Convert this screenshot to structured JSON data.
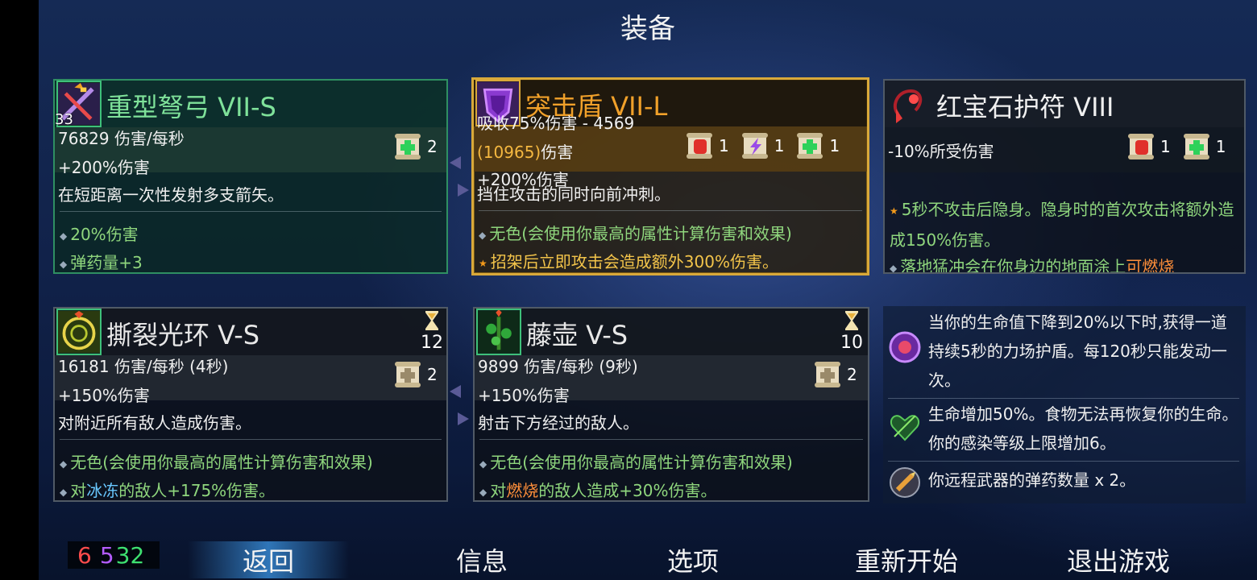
{
  "header": {
    "title": "装备"
  },
  "weapons": [
    {
      "name": "重型弩弓 VII-S",
      "level": "33",
      "dps": "76829 伤害/每秒",
      "bonus": "+200%伤害",
      "description": "在短距离一次性发射多支箭矢。",
      "scrolls": [
        {
          "icon": "health-scroll-icon",
          "count": "2"
        }
      ],
      "affixes": [
        "20%伤害",
        "弹药量+3"
      ]
    },
    {
      "name": "突击盾 VII-L",
      "block": "吸收75%伤害 - 4569",
      "damage_value": "(10965)",
      "damage_label": "伤害",
      "bonus": "+200%伤害",
      "description": "挡住攻击的同时向前冲刺。",
      "scrolls": [
        {
          "icon": "brutality-scroll-icon",
          "count": "1"
        },
        {
          "icon": "tactics-scroll-icon",
          "count": "1"
        },
        {
          "icon": "health-scroll-icon",
          "count": "1"
        }
      ],
      "affixes": [
        "无色(会使用你最高的属性计算伤害和效果)"
      ],
      "legendary_affix": "招架后立即攻击会造成额外300%伤害。"
    }
  ],
  "amulet": {
    "name": "红宝石护符 VIII",
    "stat": "-10%所受伤害",
    "scrolls": [
      {
        "icon": "brutality-scroll-icon",
        "count": "1"
      },
      {
        "icon": "health-scroll-icon",
        "count": "1"
      }
    ],
    "affix_1": "5秒不攻击后隐身。隐身时的首次攻击将额外造成150%伤害。",
    "affix_2_pre": "落地猛冲会在你身边的地面涂上",
    "affix_2_fire": "可燃烧"
  },
  "skills": [
    {
      "name": "撕裂光环 V-S",
      "cooldown": "12",
      "dps": "16181 伤害/每秒 (4秒)",
      "bonus": "+150%伤害",
      "description": "对附近所有敌人造成伤害。",
      "scrolls": [
        {
          "icon": "colorless-scroll-icon",
          "count": "2"
        }
      ],
      "affix_1": "无色(会使用你最高的属性计算伤害和效果)",
      "affix_2_pre": "对",
      "affix_2_keyword": "冰冻",
      "affix_2_post": "的敌人+175%伤害。"
    },
    {
      "name": "藤壶 V-S",
      "cooldown": "10",
      "dps": "9899 伤害/每秒 (9秒)",
      "bonus": "+150%伤害",
      "description": "射击下方经过的敌人。",
      "scrolls": [
        {
          "icon": "colorless-scroll-icon",
          "count": "2"
        }
      ],
      "affix_1": "无色(会使用你最高的属性计算伤害和效果)",
      "affix_2_pre": "对",
      "affix_2_keyword": "燃烧",
      "affix_2_post": "的敌人造成+30%伤害。"
    }
  ],
  "mutations": [
    {
      "icon": "force-shield-icon",
      "text": "当你的生命值下降到20%以下时,获得一道持续5秒的力场护盾。每120秒只能发动一次。"
    },
    {
      "icon": "vine-heart-icon",
      "text": "生命增加50%。食物无法再恢复你的生命。你的感染等级上限增加6。"
    },
    {
      "icon": "ammo-icon",
      "text": "你远程武器的弹药数量 x 2。"
    }
  ],
  "stats": {
    "brutality": "6",
    "tactics": "5",
    "survival": "32"
  },
  "menu": {
    "back": "返回",
    "info": "信息",
    "options": "选项",
    "restart": "重新开始",
    "quit": "退出游戏"
  },
  "colors": {
    "legendary": "#d9a93a",
    "green_border": "#2f8f62",
    "ice": "#69c8ff",
    "fire": "#ff8f3a"
  }
}
